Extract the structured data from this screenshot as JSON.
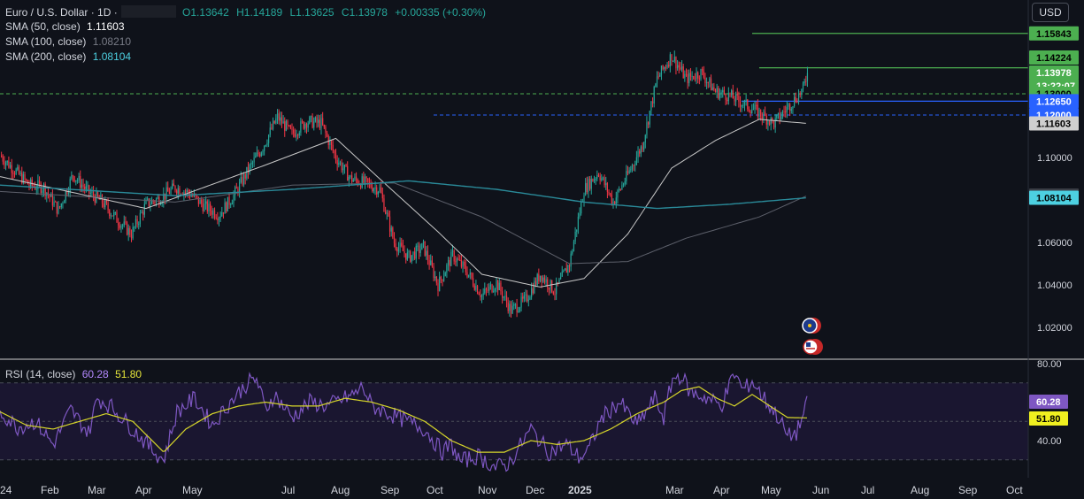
{
  "header": {
    "symbol": "Euro / U.S. Dollar · 1D ·",
    "ohlc": {
      "o": "O1.13642",
      "h": "H1.14189",
      "l": "L1.13625",
      "c": "C1.13978",
      "chg": "+0.00335 (+0.30%)"
    },
    "currency_button": "USD"
  },
  "legend": [
    {
      "label": "SMA (50, close)",
      "value": "1.11603",
      "color": "#ffffff"
    },
    {
      "label": "SMA (100, close)",
      "value": "1.08210",
      "color": "#787b86"
    },
    {
      "label": "SMA (200, close)",
      "value": "1.08104",
      "color": "#4dd0e1"
    }
  ],
  "rsi_legend": {
    "label": "RSI (14, close)",
    "rsi": "60.28",
    "ma": "51.80"
  },
  "colors": {
    "up": "#26a69a",
    "down": "#f23645",
    "rsi": "#7e57c2",
    "rsi_ma": "#d6d62a",
    "sma50": "#c8c8c8",
    "sma100": "#5d606b",
    "sma200": "#2a8a99",
    "green_line": "#4caf50",
    "blue_line": "#2962ff"
  },
  "chart_data": [
    {
      "type": "candlestick",
      "title": "Euro / U.S. Dollar · 1D",
      "ylim": [
        1.0,
        1.17
      ],
      "y_ticks": [
        "1.10000",
        "1.06000",
        "1.04000",
        "1.02000"
      ],
      "x_ticks": [
        "24",
        "Feb",
        "Mar",
        "Apr",
        "May",
        "Jul",
        "Aug",
        "Sep",
        "Oct",
        "Nov",
        "Dec",
        "2025",
        "Mar",
        "Apr",
        "May",
        "Jun",
        "Jul",
        "Aug",
        "Sep",
        "Oct"
      ],
      "close_path": [
        [
          0,
          1.101
        ],
        [
          10,
          1.094
        ],
        [
          20,
          1.087
        ],
        [
          30,
          1.086
        ],
        [
          40,
          1.075
        ],
        [
          50,
          1.092
        ],
        [
          60,
          1.084
        ],
        [
          70,
          1.079
        ],
        [
          80,
          1.071
        ],
        [
          90,
          1.064
        ],
        [
          100,
          1.078
        ],
        [
          110,
          1.081
        ],
        [
          120,
          1.086
        ],
        [
          130,
          1.083
        ],
        [
          140,
          1.077
        ],
        [
          150,
          1.073
        ],
        [
          160,
          1.082
        ],
        [
          170,
          1.094
        ],
        [
          180,
          1.105
        ],
        [
          190,
          1.119
        ],
        [
          200,
          1.111
        ],
        [
          210,
          1.117
        ],
        [
          220,
          1.116
        ],
        [
          230,
          1.1
        ],
        [
          240,
          1.09
        ],
        [
          250,
          1.088
        ],
        [
          260,
          1.085
        ],
        [
          270,
          1.06
        ],
        [
          280,
          1.053
        ],
        [
          290,
          1.058
        ],
        [
          300,
          1.04
        ],
        [
          310,
          1.054
        ],
        [
          320,
          1.046
        ],
        [
          330,
          1.035
        ],
        [
          340,
          1.041
        ],
        [
          350,
          1.028
        ],
        [
          360,
          1.033
        ],
        [
          370,
          1.045
        ],
        [
          380,
          1.037
        ],
        [
          390,
          1.05
        ],
        [
          400,
          1.085
        ],
        [
          410,
          1.093
        ],
        [
          420,
          1.079
        ],
        [
          430,
          1.092
        ],
        [
          440,
          1.106
        ],
        [
          450,
          1.137
        ],
        [
          460,
          1.148
        ],
        [
          470,
          1.137
        ],
        [
          480,
          1.14
        ],
        [
          490,
          1.131
        ],
        [
          500,
          1.129
        ],
        [
          510,
          1.125
        ],
        [
          520,
          1.121
        ],
        [
          530,
          1.116
        ],
        [
          540,
          1.124
        ],
        [
          550,
          1.132
        ],
        [
          553,
          1.13978
        ]
      ],
      "sma": [
        {
          "name": "SMA (50, close)",
          "points": [
            [
              0,
              1.091
            ],
            [
              100,
              1.076
            ],
            [
              180,
              1.096
            ],
            [
              230,
              1.109
            ],
            [
              260,
              1.09
            ],
            [
              300,
              1.065
            ],
            [
              330,
              1.045
            ],
            [
              370,
              1.039
            ],
            [
              400,
              1.043
            ],
            [
              430,
              1.064
            ],
            [
              460,
              1.095
            ],
            [
              490,
              1.108
            ],
            [
              520,
              1.118
            ],
            [
              553,
              1.11603
            ]
          ]
        },
        {
          "name": "SMA (100, close)",
          "points": [
            [
              0,
              1.084
            ],
            [
              120,
              1.079
            ],
            [
              200,
              1.087
            ],
            [
              270,
              1.088
            ],
            [
              330,
              1.072
            ],
            [
              390,
              1.05
            ],
            [
              430,
              1.051
            ],
            [
              470,
              1.062
            ],
            [
              520,
              1.072
            ],
            [
              553,
              1.0821
            ]
          ]
        },
        {
          "name": "SMA (200, close)",
          "points": [
            [
              0,
              1.087
            ],
            [
              120,
              1.082
            ],
            [
              200,
              1.085
            ],
            [
              280,
              1.089
            ],
            [
              340,
              1.085
            ],
            [
              400,
              1.079
            ],
            [
              450,
              1.076
            ],
            [
              500,
              1.078
            ],
            [
              553,
              1.08104
            ]
          ]
        }
      ],
      "price_labels": [
        {
          "value": "1.15843",
          "price": 1.15843,
          "bg": "#4caf50",
          "fg": "#000000"
        },
        {
          "value": "1.14224",
          "price": 1.14224,
          "bg": "#4caf50",
          "fg": "#000000"
        },
        {
          "value": "1.13978",
          "price": 1.13978,
          "bg": "#4caf50",
          "fg": "#ffffff"
        },
        {
          "value": "13:22:07",
          "price": 1.136,
          "bg": "#4caf50",
          "fg": "#ffffff"
        },
        {
          "value": "1.13000",
          "price": 1.13,
          "bg": "#4caf50",
          "fg": "#000000"
        },
        {
          "value": "1.12650",
          "price": 1.1265,
          "bg": "#2962ff",
          "fg": "#ffffff"
        },
        {
          "value": "1.12000",
          "price": 1.12,
          "bg": "#2962ff",
          "fg": "#ffffff"
        },
        {
          "value": "1.11603",
          "price": 1.11603,
          "bg": "#cfcfcf",
          "fg": "#000000"
        },
        {
          "value": "1.08210",
          "price": 1.0821,
          "bg": "#3a3d45",
          "fg": "#ffffff"
        },
        {
          "value": "1.08104",
          "price": 1.08104,
          "bg": "#4dd0e1",
          "fg": "#000000"
        }
      ],
      "horizontal_lines": [
        {
          "price": 1.15843,
          "style": "solid",
          "color": "#4caf50"
        },
        {
          "price": 1.14224,
          "style": "solid",
          "color": "#4caf50"
        },
        {
          "price": 1.13,
          "style": "dashed",
          "color": "#4caf50"
        },
        {
          "price": 1.1265,
          "style": "solid",
          "color": "#2962ff"
        },
        {
          "price": 1.12,
          "style": "dashed",
          "color": "#2962ff"
        }
      ],
      "grid": false
    },
    {
      "type": "line",
      "title": "RSI (14, close)",
      "ylim": [
        20,
        80
      ],
      "y_ticks": [
        "80.00",
        "40.00"
      ],
      "band": [
        30,
        70
      ],
      "series": [
        {
          "name": "RSI",
          "values": [
            [
              0,
              55
            ],
            [
              20,
              47
            ],
            [
              40,
              50
            ],
            [
              60,
              38
            ],
            [
              80,
              56
            ],
            [
              100,
              44
            ],
            [
              110,
              62
            ],
            [
              125,
              58
            ],
            [
              150,
              46
            ],
            [
              175,
              34
            ],
            [
              185,
              30
            ],
            [
              200,
              55
            ],
            [
              220,
              62
            ],
            [
              240,
              48
            ],
            [
              260,
              60
            ],
            [
              280,
              70
            ],
            [
              290,
              72
            ],
            [
              300,
              56
            ],
            [
              310,
              64
            ],
            [
              330,
              52
            ],
            [
              350,
              60
            ],
            [
              370,
              58
            ],
            [
              400,
              64
            ],
            [
              410,
              68
            ],
            [
              420,
              58
            ],
            [
              440,
              54
            ],
            [
              460,
              50
            ],
            [
              480,
              46
            ],
            [
              500,
              34
            ],
            [
              510,
              38
            ],
            [
              520,
              29
            ],
            [
              540,
              32
            ],
            [
              560,
              26
            ],
            [
              575,
              28
            ],
            [
              600,
              46
            ],
            [
              620,
              34
            ],
            [
              640,
              38
            ],
            [
              655,
              31
            ],
            [
              665,
              35
            ],
            [
              680,
              52
            ],
            [
              700,
              60
            ],
            [
              720,
              48
            ],
            [
              740,
              62
            ],
            [
              750,
              52
            ],
            [
              760,
              72
            ],
            [
              770,
              74
            ],
            [
              780,
              65
            ],
            [
              800,
              62
            ],
            [
              815,
              58
            ],
            [
              830,
              75
            ],
            [
              840,
              66
            ],
            [
              850,
              71
            ],
            [
              860,
              64
            ],
            [
              880,
              52
            ],
            [
              890,
              42
            ],
            [
              900,
              44
            ],
            [
              910,
              56
            ],
            [
              913,
              60.28
            ]
          ]
        },
        {
          "name": "MA",
          "values": [
            [
              0,
              55
            ],
            [
              30,
              48
            ],
            [
              60,
              46
            ],
            [
              90,
              50
            ],
            [
              120,
              54
            ],
            [
              150,
              50
            ],
            [
              185,
              34
            ],
            [
              210,
              46
            ],
            [
              240,
              54
            ],
            [
              270,
              58
            ],
            [
              300,
              60
            ],
            [
              330,
              58
            ],
            [
              360,
              58
            ],
            [
              390,
              62
            ],
            [
              420,
              60
            ],
            [
              450,
              56
            ],
            [
              480,
              50
            ],
            [
              510,
              40
            ],
            [
              540,
              34
            ],
            [
              570,
              34
            ],
            [
              600,
              40
            ],
            [
              630,
              38
            ],
            [
              660,
              40
            ],
            [
              690,
              46
            ],
            [
              720,
              54
            ],
            [
              750,
              60
            ],
            [
              770,
              66
            ],
            [
              790,
              68
            ],
            [
              810,
              62
            ],
            [
              830,
              58
            ],
            [
              850,
              64
            ],
            [
              870,
              58
            ],
            [
              890,
              52
            ],
            [
              913,
              51.8
            ]
          ]
        }
      ]
    }
  ]
}
